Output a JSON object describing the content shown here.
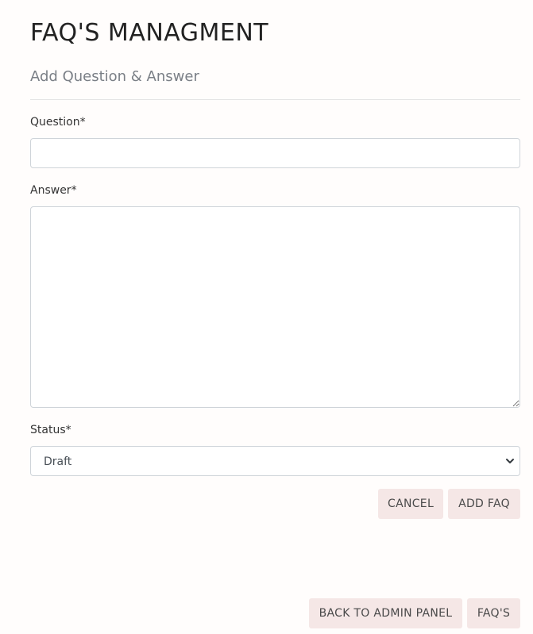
{
  "header": {
    "title": "FAQ'S MANAGMENT",
    "subtitle": "Add Question & Answer"
  },
  "form": {
    "question": {
      "label": "Question*",
      "value": "",
      "placeholder": ""
    },
    "answer": {
      "label": "Answer*",
      "value": "",
      "placeholder": ""
    },
    "status": {
      "label": "Status*",
      "selected": "Draft"
    },
    "actions": {
      "cancel_label": "CANCEL",
      "submit_label": "ADD FAQ"
    }
  },
  "footer_nav": {
    "back_label": "BACK TO ADMIN PANEL",
    "faqs_label": "FAQ'S"
  },
  "colors": {
    "button_bg": "#f5e7e6",
    "subtitle": "#7a7f86",
    "border": "#cfd4d9"
  }
}
